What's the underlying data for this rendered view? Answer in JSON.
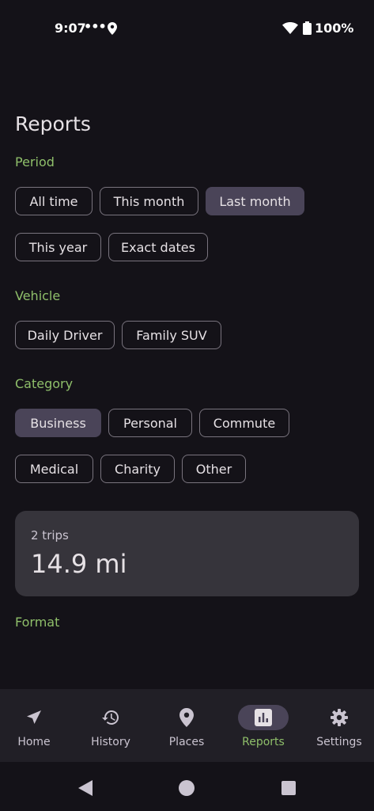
{
  "status": {
    "time": "9:07",
    "dots": "•••",
    "battery": "100%"
  },
  "page": {
    "title": "Reports"
  },
  "period": {
    "label": "Period",
    "chips": [
      {
        "label": "All time",
        "selected": false
      },
      {
        "label": "This month",
        "selected": false
      },
      {
        "label": "Last month",
        "selected": true
      },
      {
        "label": "This year",
        "selected": false
      },
      {
        "label": "Exact dates",
        "selected": false
      }
    ]
  },
  "vehicle": {
    "label": "Vehicle",
    "chips": [
      {
        "label": "Daily Driver",
        "selected": false
      },
      {
        "label": "Family SUV",
        "selected": false
      }
    ]
  },
  "category": {
    "label": "Category",
    "chips": [
      {
        "label": "Business",
        "selected": true
      },
      {
        "label": "Personal",
        "selected": false
      },
      {
        "label": "Commute",
        "selected": false
      },
      {
        "label": "Medical",
        "selected": false
      },
      {
        "label": "Charity",
        "selected": false
      },
      {
        "label": "Other",
        "selected": false
      }
    ]
  },
  "summary": {
    "trips": "2 trips",
    "distance": "14.9 mi"
  },
  "format": {
    "label": "Format"
  },
  "nav": {
    "items": [
      {
        "label": "Home",
        "icon": "navigation-arrow-icon",
        "active": false
      },
      {
        "label": "History",
        "icon": "history-icon",
        "active": false
      },
      {
        "label": "Places",
        "icon": "location-pin-icon",
        "active": false
      },
      {
        "label": "Reports",
        "icon": "bar-chart-icon",
        "active": true
      },
      {
        "label": "Settings",
        "icon": "gear-icon",
        "active": false
      }
    ]
  },
  "colors": {
    "accent": "#8fbf6a",
    "selected_chip": "#4a4458",
    "background": "#141218",
    "card": "#36343b"
  }
}
